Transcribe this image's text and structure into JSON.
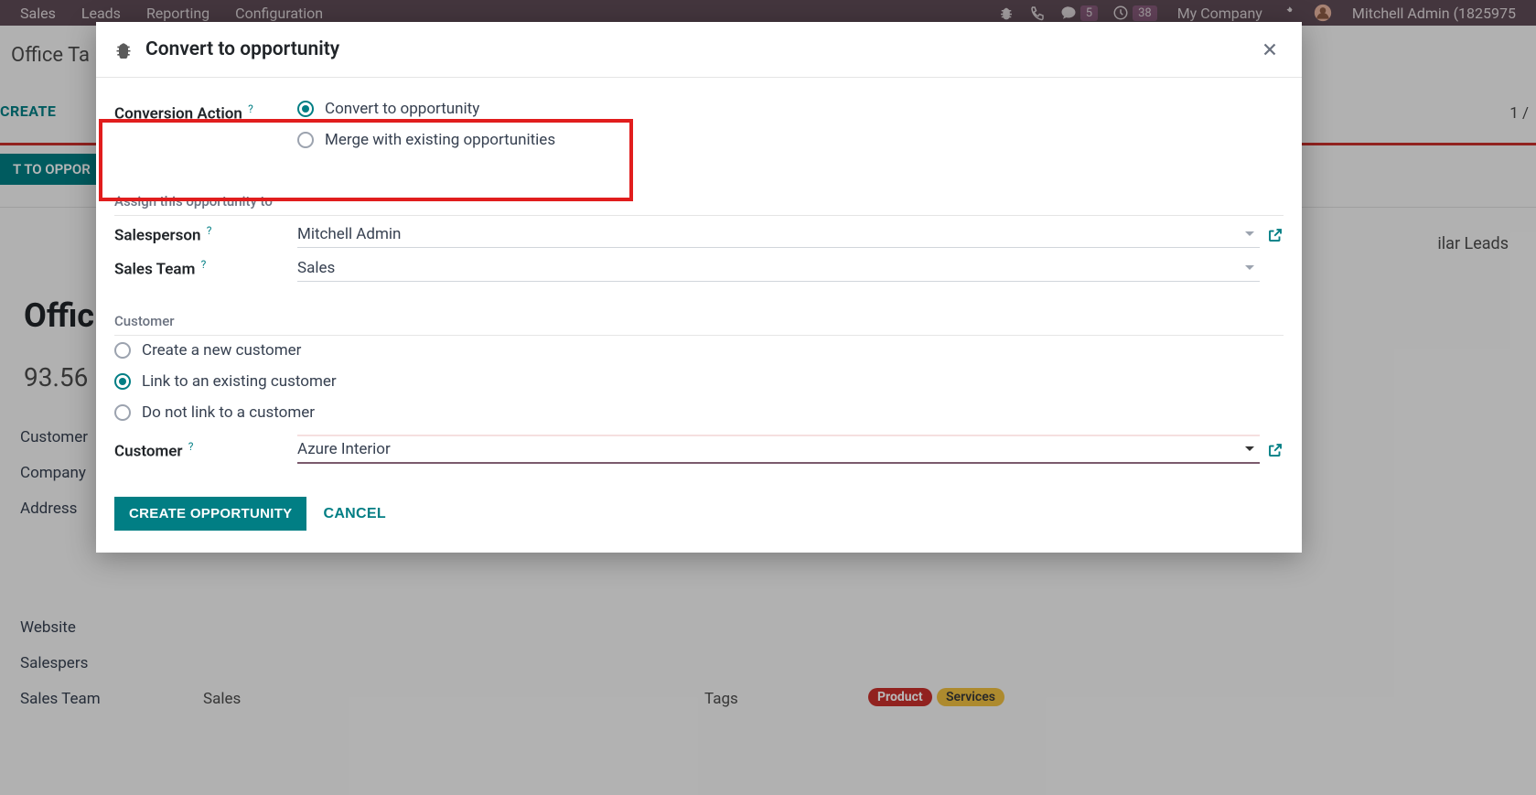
{
  "navbar": {
    "items": [
      "Sales",
      "Leads",
      "Reporting",
      "Configuration"
    ],
    "msg_count": "5",
    "clock_count": "38",
    "company": "My Company",
    "user": "Mitchell Admin (1825975"
  },
  "background": {
    "breadcrumb": "Office Ta",
    "create": "CREATE",
    "convert_btn": "T TO OPPOR",
    "pager": "1 /",
    "similar_leads": "ilar Leads",
    "big_title": "Offic",
    "big_num": "93.56",
    "labels": {
      "customer": "Customer",
      "company": "Company",
      "address": "Address",
      "website": "Website",
      "salesperson": "Salespers",
      "sales_team": "Sales Team"
    },
    "sales_value": "Sales",
    "tags_label": "Tags",
    "tag_product": "Product",
    "tag_services": "Services"
  },
  "modal": {
    "title": "Convert to opportunity",
    "conversion_action_label": "Conversion Action",
    "radio_convert": "Convert to opportunity",
    "radio_merge": "Merge with existing opportunities",
    "assign_section": "Assign this opportunity to",
    "salesperson_label": "Salesperson",
    "salesperson_value": "Mitchell Admin",
    "sales_team_label": "Sales Team",
    "sales_team_value": "Sales",
    "customer_section": "Customer",
    "radio_create_cust": "Create a new customer",
    "radio_link_cust": "Link to an existing customer",
    "radio_no_link": "Do not link to a customer",
    "customer_label": "Customer",
    "customer_value": "Azure Interior",
    "btn_create": "CREATE OPPORTUNITY",
    "btn_cancel": "CANCEL",
    "help": "?"
  }
}
